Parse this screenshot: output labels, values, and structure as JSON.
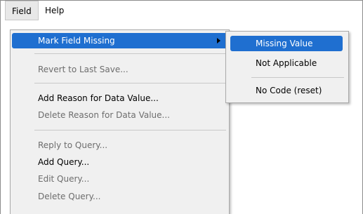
{
  "menubar": {
    "items": [
      {
        "label": "Field",
        "active": true
      },
      {
        "label": "Help",
        "active": false
      }
    ]
  },
  "field_menu": {
    "items": [
      {
        "label": "Mark Field Missing",
        "enabled": true,
        "highlighted": true,
        "has_submenu": true
      },
      {
        "label": "Revert to Last Save...",
        "enabled": false
      },
      {
        "label": "Add Reason for Data Value...",
        "enabled": true
      },
      {
        "label": "Delete Reason for Data Value...",
        "enabled": false
      },
      {
        "label": "Reply to Query...",
        "enabled": false
      },
      {
        "label": "Add Query...",
        "enabled": true
      },
      {
        "label": "Edit Query...",
        "enabled": false
      },
      {
        "label": "Delete Query...",
        "enabled": false
      }
    ]
  },
  "submenu": {
    "items": [
      {
        "label": "Missing Value",
        "highlighted": true
      },
      {
        "label": "Not Applicable",
        "highlighted": false
      },
      {
        "label": "No Code (reset)",
        "highlighted": false
      }
    ]
  },
  "colors": {
    "highlight": "#1f6fd0",
    "menu_bg": "#f0f0f0",
    "disabled_text": "#6d6d6d"
  },
  "icons": {
    "submenu_arrow": "triangle-right-icon"
  }
}
